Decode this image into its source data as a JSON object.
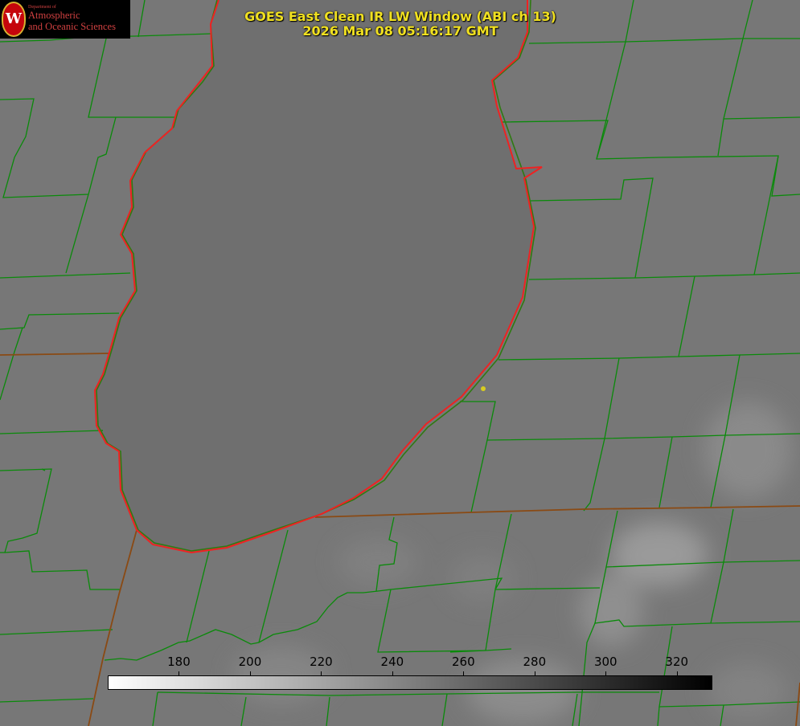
{
  "title": {
    "line1": "GOES East Clean IR LW Window (ABI ch 13)",
    "line2": "2026 Mar 08 05:16:17 GMT"
  },
  "logo": {
    "dept": "Department of",
    "line1": "Atmospheric",
    "line2": "and Oceanic Sciences",
    "seal_letter": "W"
  },
  "colorbar": {
    "min": 160,
    "max": 330,
    "tick_values": [
      180,
      200,
      220,
      240,
      260,
      280,
      300,
      320
    ],
    "tick_labels": [
      "180",
      "200",
      "220",
      "240",
      "260",
      "280",
      "300",
      "320"
    ],
    "color_start": "#ffffff",
    "color_end": "#000000"
  },
  "colors": {
    "background": "#777777",
    "county_lines": "#0a8a0a",
    "state_lines": "#8a4a14",
    "lake_outline": "#ee2222",
    "title_text": "#f0e020",
    "marker": "#d8cc20"
  },
  "map": {
    "features": [
      "lake-michigan-southern-basin",
      "county-boundaries",
      "state-boundaries",
      "city-marker"
    ]
  }
}
